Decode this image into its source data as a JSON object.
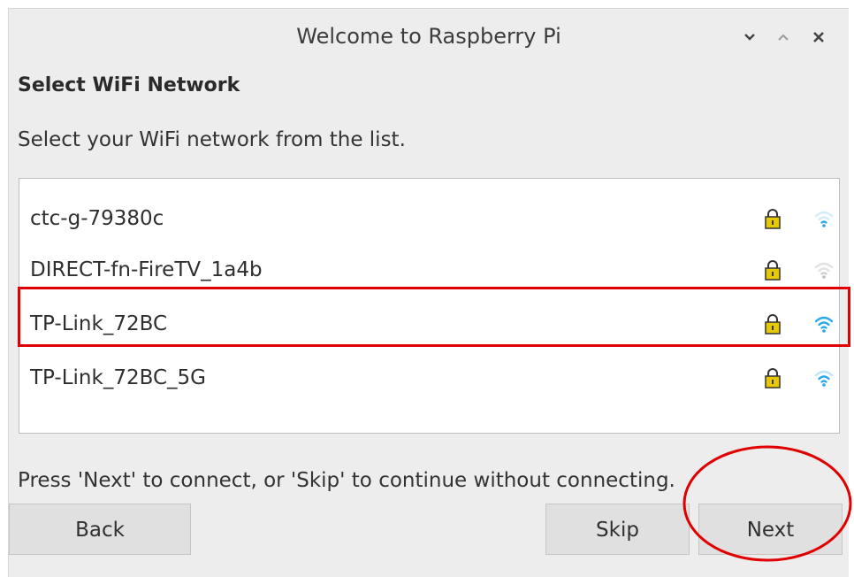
{
  "window": {
    "title": "Welcome to Raspberry Pi",
    "controls": [
      "chevron-down-icon",
      "chevron-up-icon",
      "close-icon"
    ]
  },
  "heading": "Select WiFi Network",
  "description": "Select your WiFi network from the list.",
  "networks": [
    {
      "ssid": "ctc-g-79380c",
      "secured": true,
      "signal": "weak"
    },
    {
      "ssid": "DIRECT-fn-FireTV_1a4b",
      "secured": true,
      "signal": "weak"
    },
    {
      "ssid": "TP-Link_72BC",
      "secured": true,
      "signal": "strong"
    },
    {
      "ssid": "TP-Link_72BC_5G",
      "secured": true,
      "signal": "medium"
    }
  ],
  "hint": "Press 'Next' to connect, or 'Skip' to continue without connecting.",
  "buttons": {
    "back": "Back",
    "skip": "Skip",
    "next": "Next"
  },
  "colors": {
    "annotation": "#e00000",
    "wifi_active": "#2aa7e6",
    "wifi_inactive": "#bfe3f5",
    "lock_body": "#e8c900"
  }
}
